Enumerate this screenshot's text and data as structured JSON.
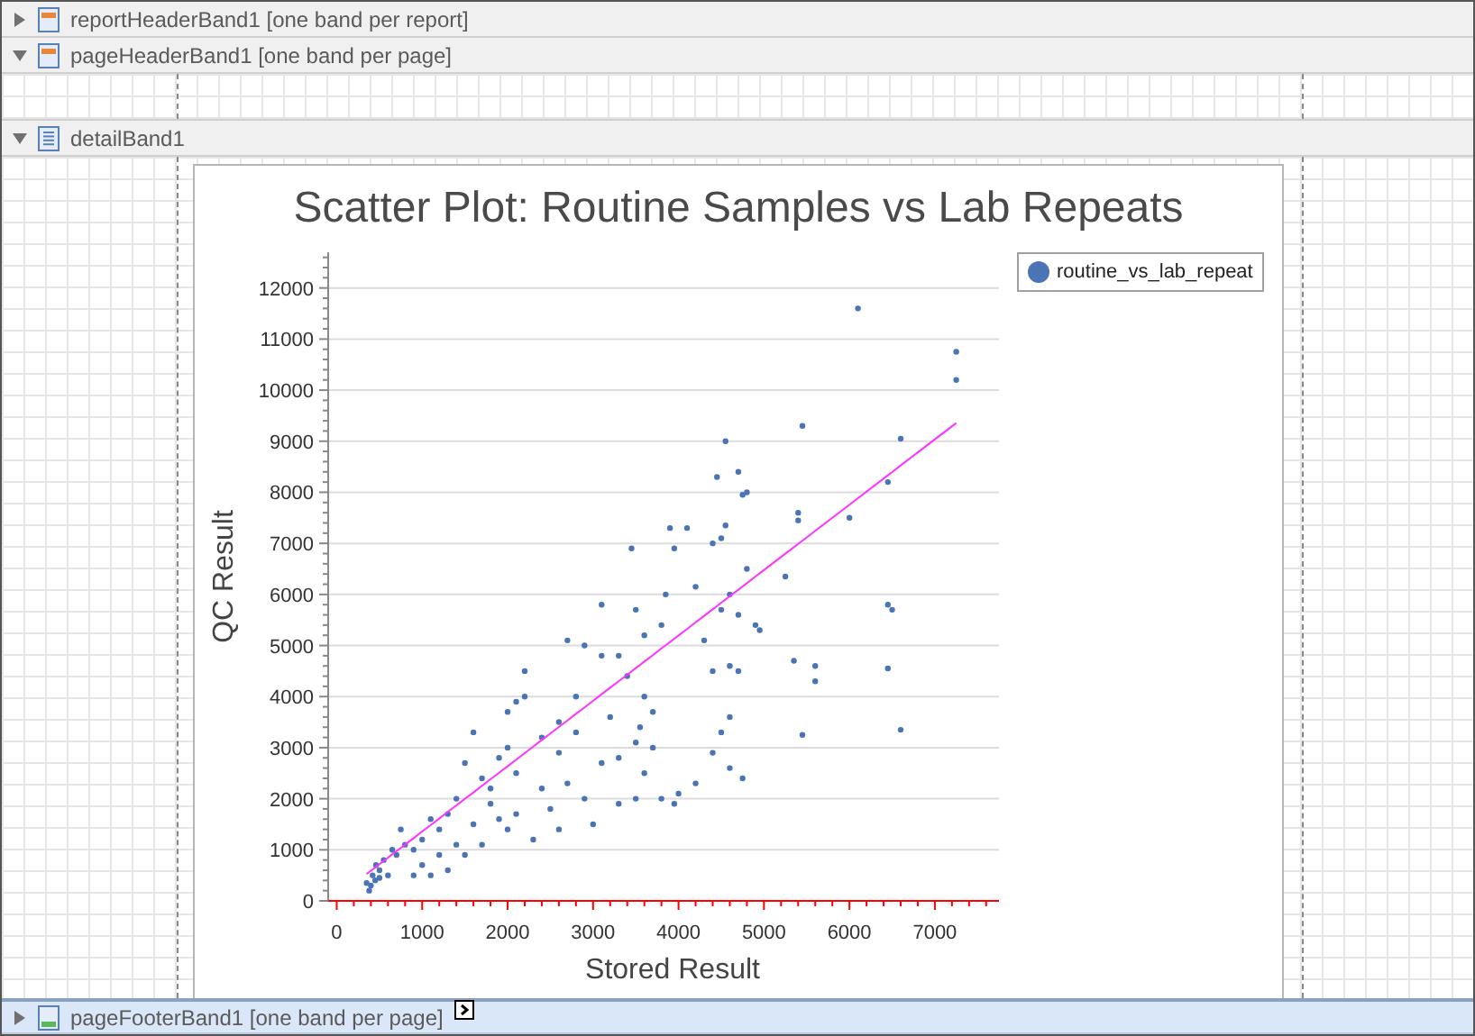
{
  "bands": [
    {
      "kind": "report-header",
      "label": "reportHeaderBand1 [one band per report]",
      "expanded": false,
      "selected": false
    },
    {
      "kind": "page-header",
      "label": "pageHeaderBand1 [one band per page]",
      "expanded": true,
      "selected": false
    },
    {
      "kind": "detail",
      "label": "detailBand1",
      "expanded": true,
      "selected": false,
      "chart": {
        "title": "Scatter Plot: Routine Samples vs Lab Repeats",
        "chart_data": {
          "type": "scatter",
          "grid": true,
          "xlabel": "Stored Result",
          "ylabel": "QC Result",
          "xlim": [
            -100,
            7750
          ],
          "ylim": [
            0,
            12700
          ],
          "xticks": [
            0,
            1000,
            2000,
            3000,
            4000,
            5000,
            6000,
            7000
          ],
          "yticks": [
            0,
            1000,
            2000,
            3000,
            4000,
            5000,
            6000,
            7000,
            8000,
            9000,
            10000,
            11000,
            12000
          ],
          "x": [
            6100,
            7250,
            7250,
            6600,
            6450,
            5450,
            5400,
            5400,
            6000,
            6450,
            6500,
            6450,
            6600,
            5450,
            5350,
            5600,
            5600,
            5250,
            4550,
            4700,
            4800,
            4750,
            4450,
            4550,
            4500,
            4100,
            3900,
            3950,
            4400,
            4200,
            4800,
            4600,
            4500,
            4700,
            4900,
            4950,
            4600,
            4700,
            4400,
            4600,
            4500,
            4600,
            4750,
            4400,
            4200,
            4000,
            3950,
            3800,
            4300,
            3850,
            3800,
            3600,
            3450,
            3500,
            3300,
            3400,
            3600,
            3700,
            3550,
            3500,
            3700,
            3300,
            3600,
            3500,
            3300,
            3000,
            3100,
            3100,
            2900,
            2800,
            2700,
            2600,
            2800,
            2600,
            2400,
            2700,
            2500,
            2200,
            2100,
            2200,
            2000,
            2000,
            2100,
            1900,
            1800,
            1700,
            1600,
            1500,
            1800,
            1600,
            1400,
            1300,
            1400,
            1200,
            1100,
            1000,
            900,
            800,
            700,
            1200,
            1000,
            1500,
            1700,
            900,
            600,
            500,
            450,
            400,
            380,
            420,
            350,
            460,
            500,
            550,
            650,
            750,
            2300,
            2100,
            2400,
            2900,
            3100,
            3200,
            1900,
            2000,
            2600,
            1300,
            1100
          ],
          "series": [
            {
              "name": "routine_vs_lab_repeat",
              "color": "#4a74b4",
              "values": [
                11600,
                10750,
                10200,
                9050,
                8200,
                9300,
                7600,
                7450,
                7500,
                5800,
                5700,
                4550,
                3350,
                3250,
                4700,
                4600,
                4300,
                6350,
                9000,
                8400,
                8000,
                7950,
                8300,
                7350,
                7100,
                7300,
                7300,
                6900,
                7000,
                6150,
                6500,
                6000,
                5700,
                5600,
                5400,
                5300,
                4600,
                4500,
                4500,
                3600,
                3300,
                2600,
                2400,
                2900,
                2300,
                2100,
                1900,
                2000,
                5100,
                6000,
                5400,
                5200,
                6900,
                5700,
                4800,
                4400,
                4000,
                3700,
                3400,
                3100,
                3000,
                2800,
                2500,
                2000,
                1900,
                1500,
                5800,
                4800,
                5000,
                4000,
                5100,
                3500,
                3300,
                2900,
                3200,
                2300,
                1800,
                4000,
                3900,
                4500,
                3700,
                3000,
                2500,
                2800,
                2200,
                2400,
                3300,
                2700,
                1900,
                1500,
                2000,
                1700,
                1100,
                1400,
                1600,
                1200,
                1000,
                1100,
                900,
                900,
                700,
                900,
                1100,
                500,
                500,
                600,
                400,
                300,
                200,
                500,
                350,
                700,
                450,
                800,
                1000,
                1400,
                1200,
                1700,
                2200,
                2000,
                2700,
                3600,
                1600,
                1400,
                1400,
                600,
                500
              ]
            },
            {
              "type": "line",
              "color": "#ff33ff",
              "values": [
                7885,
                9357,
                9357,
                8525,
                8333,
                7053,
                6989,
                6989,
                7757,
                8333,
                8397,
                8333,
                8525,
                7053,
                6925,
                7245,
                7245,
                6797,
                5901,
                6093,
                6221,
                6157,
                5773,
                5901,
                5837,
                5325,
                5069,
                5133,
                5709,
                5453,
                6221,
                5965,
                5837,
                6093,
                6349,
                6413,
                5965,
                6093,
                5709,
                5965,
                5837,
                5965,
                6157,
                5709,
                5453,
                5197,
                5133,
                4941,
                5581,
                5005,
                4941,
                4685,
                4493,
                4557,
                4301,
                4429,
                4685,
                4813,
                4621,
                4557,
                4813,
                4301,
                4685,
                4557,
                4301,
                3917,
                4045,
                4045,
                3789,
                3661,
                3533,
                3405,
                3661,
                3405,
                3149,
                3533,
                3277,
                2893,
                2765,
                2893,
                2637,
                2637,
                2765,
                2509,
                2381,
                2253,
                2125,
                1997,
                2381,
                2125,
                1869,
                1741,
                1869,
                1613,
                1485,
                1357,
                1229,
                1101,
                973,
                1613,
                1357,
                1997,
                2253,
                1229,
                845,
                717,
                653,
                589,
                563,
                614,
                525,
                666,
                717,
                781,
                909,
                1037,
                3021,
                2765,
                3149,
                3789,
                4045,
                4173,
                2509,
                2637,
                3405,
                1741,
                1485
              ]
            }
          ]
        }
      }
    },
    {
      "kind": "page-footer",
      "label": "pageFooterBand1 [one band per page]",
      "expanded": false,
      "selected": true
    }
  ]
}
